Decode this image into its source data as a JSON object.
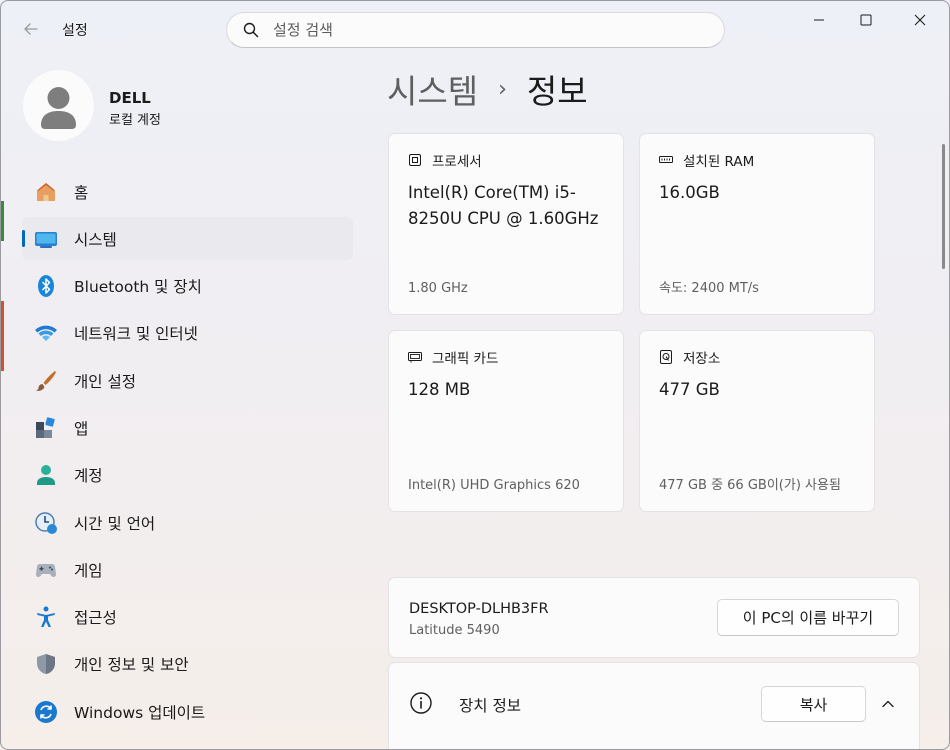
{
  "titlebar": {
    "app_title": "설정",
    "search_placeholder": "설정 검색"
  },
  "profile": {
    "name": "DELL",
    "account_type": "로컬 계정"
  },
  "sidebar": {
    "items": [
      {
        "label": "홈",
        "icon": "home-icon"
      },
      {
        "label": "시스템",
        "icon": "system-icon",
        "active": true
      },
      {
        "label": "Bluetooth 및 장치",
        "icon": "bluetooth-icon"
      },
      {
        "label": "네트워크 및 인터넷",
        "icon": "wifi-icon"
      },
      {
        "label": "개인 설정",
        "icon": "brush-icon"
      },
      {
        "label": "앱",
        "icon": "apps-icon"
      },
      {
        "label": "계정",
        "icon": "account-icon"
      },
      {
        "label": "시간 및 언어",
        "icon": "time-language-icon"
      },
      {
        "label": "게임",
        "icon": "gamepad-icon"
      },
      {
        "label": "접근성",
        "icon": "accessibility-icon"
      },
      {
        "label": "개인 정보 및 보안",
        "icon": "shield-icon"
      },
      {
        "label": "Windows 업데이트",
        "icon": "update-icon"
      }
    ]
  },
  "breadcrumb": {
    "parent": "시스템",
    "separator": "›",
    "current": "정보"
  },
  "cards": {
    "processor": {
      "label": "프로세서",
      "value": "Intel(R) Core(TM) i5-8250U CPU @ 1.60GHz",
      "detail": "1.80 GHz"
    },
    "ram": {
      "label": "설치된 RAM",
      "value": "16.0GB",
      "detail": "속도: 2400 MT/s"
    },
    "graphics": {
      "label": "그래픽 카드",
      "value": "128 MB",
      "detail": "Intel(R) UHD Graphics 620"
    },
    "storage": {
      "label": "저장소",
      "value": "477 GB",
      "detail": "477 GB 중 66 GB이(가) 사용됨"
    }
  },
  "device": {
    "name": "DESKTOP-DLHB3FR",
    "model": "Latitude 5490",
    "rename_label": "이 PC의 이름 바꾸기"
  },
  "device_specs": {
    "title": "장치 정보",
    "copy_label": "복사"
  },
  "colors": {
    "accent": "#0067c0",
    "active_nav_bg": "#eaeaee",
    "card_bg": "#fbfbfb"
  }
}
